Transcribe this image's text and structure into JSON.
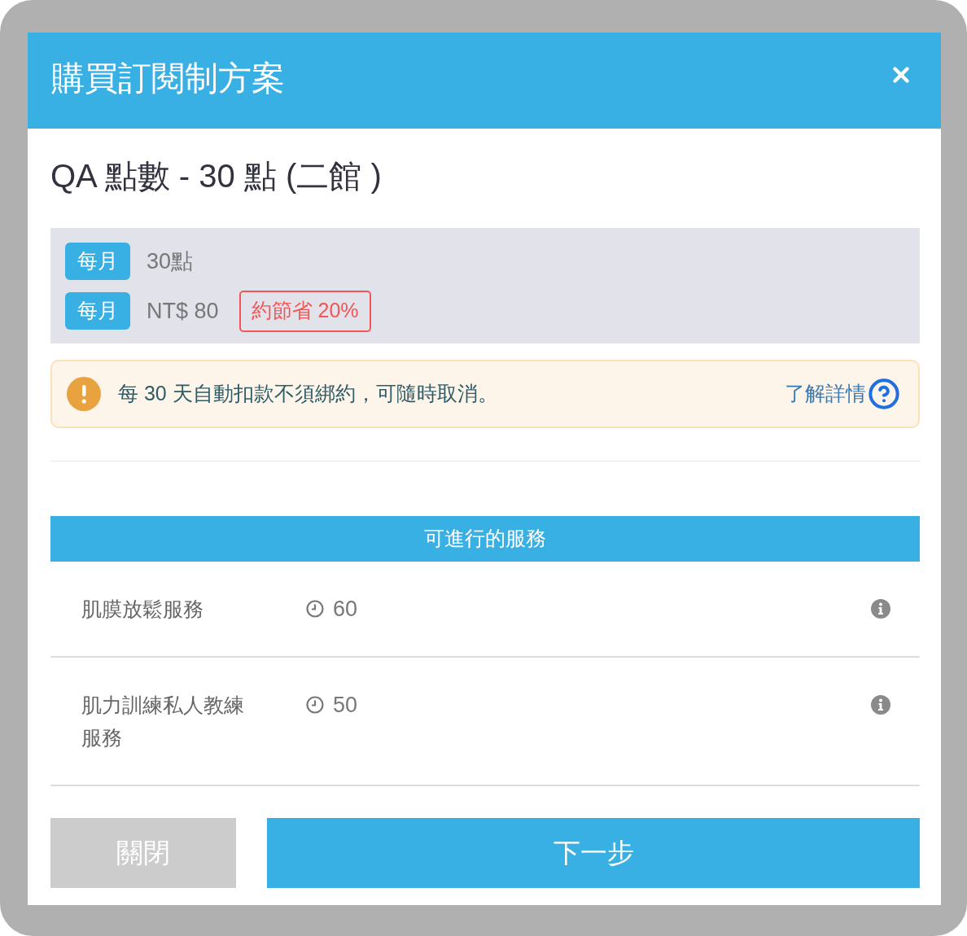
{
  "dialog": {
    "title": "購買訂閱制方案"
  },
  "plan": {
    "name": "QA 點數 - 30 點 (二館 )",
    "details": [
      {
        "badge": "每月",
        "value": "30點"
      },
      {
        "badge": "每月",
        "value": "NT$ 80",
        "tag": "約節省 20%"
      }
    ]
  },
  "notice": {
    "text": "每 30 天自動扣款不須綁約，可隨時取消。",
    "link": "了解詳情"
  },
  "services": {
    "heading": "可進行的服務",
    "rows": [
      {
        "name": "肌膜放鬆服務",
        "duration": "60"
      },
      {
        "name": "肌力訓練私人教練服務",
        "duration": "50"
      }
    ]
  },
  "buttons": [
    {
      "label": "關閉",
      "kind": "secondary"
    },
    {
      "label": "下一步",
      "kind": "primary"
    }
  ]
}
